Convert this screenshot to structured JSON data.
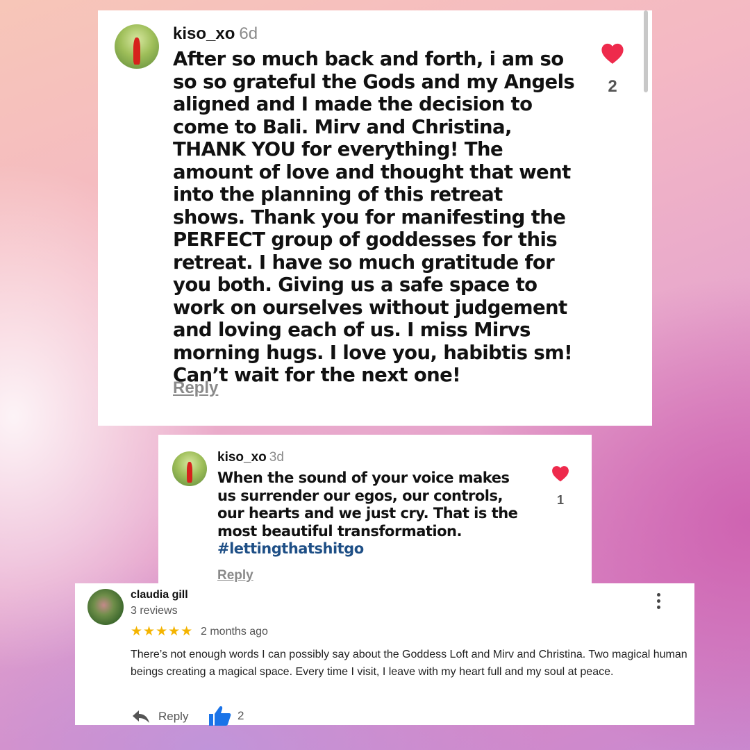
{
  "comments": [
    {
      "username": "kiso_xo",
      "time": "6d",
      "text": "After so much back and forth, i am so so so grateful the Gods and my Angels aligned and I made the decision to come to Bali. Mirv and Christina, THANK YOU for everything! The amount of love and thought that went into the planning of this retreat shows. Thank you for manifesting the PERFECT group of goddesses for this retreat. I have so much gratitude for you both. Giving us a safe space to work on ourselves without judgement and loving each of us. I miss Mirvs morning hugs. I love you, habibtis sm!  Can’t wait for the next one!",
      "reply_label": "Reply",
      "likes": "2"
    },
    {
      "username": "kiso_xo",
      "time": "3d",
      "text": "When the sound of your voice makes us surrender our egos, our controls, our hearts and we just cry. That is the most beautiful transformation.",
      "hashtag": "#lettingthatshitgo",
      "reply_label": "Reply",
      "likes": "1"
    }
  ],
  "review": {
    "name": "claudia gill",
    "reviews_count": "3 reviews",
    "stars": "★★★★★",
    "rating": 5,
    "time_ago": "2 months ago",
    "text": "There’s not enough words I can possibly say about the Goddess Loft and Mirv and Christina. Two magical human beings creating a magical space. Every time I visit, I leave with my heart full and my soul at peace.",
    "reply_label": "Reply",
    "likes": "2"
  },
  "icons": {
    "heart": "heart-icon",
    "reply": "reply-arrow-icon",
    "thumbs_up": "thumbs-up-icon",
    "more": "more-vert-icon"
  },
  "colors": {
    "heart": "#ee2a4c",
    "stars": "#f4b400",
    "thumbs_up": "#1a73e8",
    "hashtag": "#1e4f86"
  }
}
